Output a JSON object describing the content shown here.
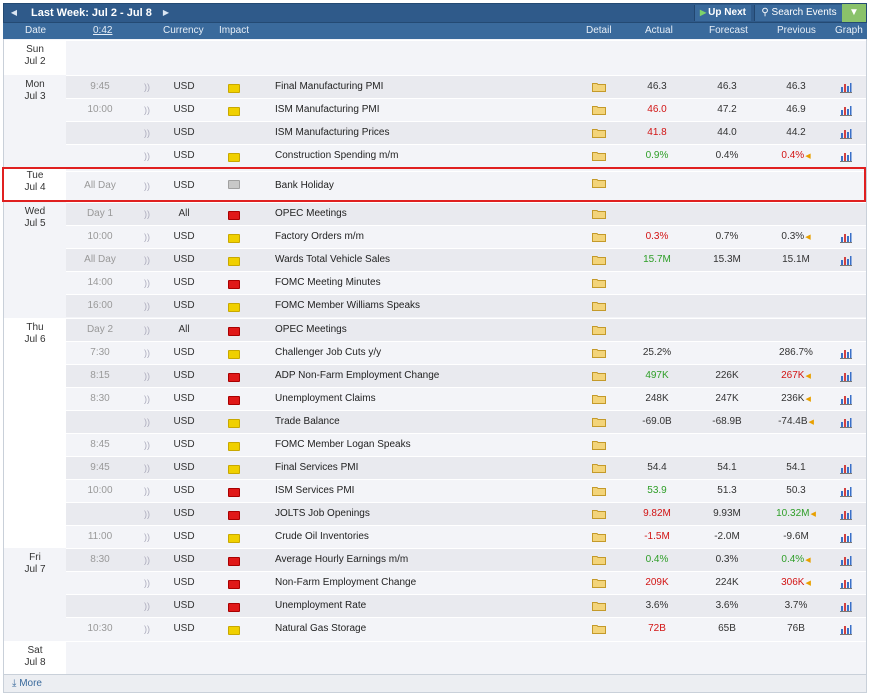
{
  "toolbar": {
    "prev_arrow": "◀",
    "title": "Last Week: Jul 2 - Jul 8",
    "next_arrow": "▶",
    "up_next_label": "Up Next",
    "search_label": "Search Events",
    "filter_icon": "filter-icon"
  },
  "columns": {
    "date": "Date",
    "time": "0:42",
    "currency": "Currency",
    "impact": "Impact",
    "detail": "Detail",
    "actual": "Actual",
    "forecast": "Forecast",
    "previous": "Previous",
    "graph": "Graph"
  },
  "colors": {
    "header_bg": "#3a6a9c",
    "actual_better": "#2e9e27",
    "actual_worse": "#d21414",
    "impact_high": "#e01818",
    "impact_medium": "#f28c28",
    "impact_low": "#f0d000",
    "impact_holiday": "#c8c8c8",
    "highlight_border": "#e02020"
  },
  "days": [
    {
      "line1": "Sun",
      "line2": "Jul 2"
    },
    {
      "line1": "Mon",
      "line2": "Jul 3"
    },
    {
      "line1": "Tue",
      "line2": "Jul 4"
    },
    {
      "line1": "Wed",
      "line2": "Jul 5"
    },
    {
      "line1": "Thu",
      "line2": "Jul 6"
    },
    {
      "line1": "Fri",
      "line2": "Jul 7"
    },
    {
      "line1": "Sat",
      "line2": "Jul 8"
    }
  ],
  "events": [
    {
      "time": "9:45",
      "currency": "USD",
      "impact": "low",
      "name": "Final Manufacturing PMI",
      "actual": "46.3",
      "actual_class": "",
      "forecast": "46.3",
      "previous": "46.3",
      "previous_class": "",
      "revised": false,
      "has_graph": true
    },
    {
      "time": "10:00",
      "currency": "USD",
      "impact": "low",
      "name": "ISM Manufacturing PMI",
      "actual": "46.0",
      "actual_class": "red",
      "forecast": "47.2",
      "previous": "46.9",
      "previous_class": "",
      "revised": false,
      "has_graph": true
    },
    {
      "time": "",
      "currency": "USD",
      "impact": "medium",
      "name": "ISM Manufacturing Prices",
      "actual": "41.8",
      "actual_class": "red",
      "forecast": "44.0",
      "previous": "44.2",
      "previous_class": "",
      "revised": false,
      "has_graph": true
    },
    {
      "time": "",
      "currency": "USD",
      "impact": "low",
      "name": "Construction Spending m/m",
      "actual": "0.9%",
      "actual_class": "green",
      "forecast": "0.4%",
      "previous": "0.4%",
      "previous_class": "red",
      "revised": true,
      "has_graph": true
    },
    {
      "time": "All Day",
      "currency": "USD",
      "impact": "none",
      "name": "Bank Holiday",
      "actual": "",
      "actual_class": "",
      "forecast": "",
      "previous": "",
      "previous_class": "",
      "revised": false,
      "has_graph": false
    },
    {
      "time": "Day 1",
      "currency": "All",
      "impact": "high",
      "name": "OPEC Meetings",
      "actual": "",
      "actual_class": "",
      "forecast": "",
      "previous": "",
      "previous_class": "",
      "revised": false,
      "has_graph": false
    },
    {
      "time": "10:00",
      "currency": "USD",
      "impact": "low",
      "name": "Factory Orders m/m",
      "actual": "0.3%",
      "actual_class": "red",
      "forecast": "0.7%",
      "previous": "0.3%",
      "previous_class": "",
      "revised": true,
      "has_graph": true
    },
    {
      "time": "All Day",
      "currency": "USD",
      "impact": "low",
      "name": "Wards Total Vehicle Sales",
      "actual": "15.7M",
      "actual_class": "green",
      "forecast": "15.3M",
      "previous": "15.1M",
      "previous_class": "",
      "revised": false,
      "has_graph": true
    },
    {
      "time": "14:00",
      "currency": "USD",
      "impact": "high",
      "name": "FOMC Meeting Minutes",
      "actual": "",
      "actual_class": "",
      "forecast": "",
      "previous": "",
      "previous_class": "",
      "revised": false,
      "has_graph": false
    },
    {
      "time": "16:00",
      "currency": "USD",
      "impact": "low",
      "name": "FOMC Member Williams Speaks",
      "actual": "",
      "actual_class": "",
      "forecast": "",
      "previous": "",
      "previous_class": "",
      "revised": false,
      "has_graph": false
    },
    {
      "time": "Day 2",
      "currency": "All",
      "impact": "high",
      "name": "OPEC Meetings",
      "actual": "",
      "actual_class": "",
      "forecast": "",
      "previous": "",
      "previous_class": "",
      "revised": false,
      "has_graph": false
    },
    {
      "time": "7:30",
      "currency": "USD",
      "impact": "low",
      "name": "Challenger Job Cuts y/y",
      "actual": "25.2%",
      "actual_class": "",
      "forecast": "",
      "previous": "286.7%",
      "previous_class": "",
      "revised": false,
      "has_graph": true
    },
    {
      "time": "8:15",
      "currency": "USD",
      "impact": "high",
      "name": "ADP Non-Farm Employment Change",
      "actual": "497K",
      "actual_class": "green",
      "forecast": "226K",
      "previous": "267K",
      "previous_class": "red",
      "revised": true,
      "has_graph": true
    },
    {
      "time": "8:30",
      "currency": "USD",
      "impact": "high",
      "name": "Unemployment Claims",
      "actual": "248K",
      "actual_class": "",
      "forecast": "247K",
      "previous": "236K",
      "previous_class": "",
      "revised": true,
      "has_graph": true
    },
    {
      "time": "",
      "currency": "USD",
      "impact": "low",
      "name": "Trade Balance",
      "actual": "-69.0B",
      "actual_class": "",
      "forecast": "-68.9B",
      "previous": "-74.4B",
      "previous_class": "",
      "revised": true,
      "has_graph": true
    },
    {
      "time": "8:45",
      "currency": "USD",
      "impact": "low",
      "name": "FOMC Member Logan Speaks",
      "actual": "",
      "actual_class": "",
      "forecast": "",
      "previous": "",
      "previous_class": "",
      "revised": false,
      "has_graph": false
    },
    {
      "time": "9:45",
      "currency": "USD",
      "impact": "low",
      "name": "Final Services PMI",
      "actual": "54.4",
      "actual_class": "",
      "forecast": "54.1",
      "previous": "54.1",
      "previous_class": "",
      "revised": false,
      "has_graph": true
    },
    {
      "time": "10:00",
      "currency": "USD",
      "impact": "high",
      "name": "ISM Services PMI",
      "actual": "53.9",
      "actual_class": "green",
      "forecast": "51.3",
      "previous": "50.3",
      "previous_class": "",
      "revised": false,
      "has_graph": true
    },
    {
      "time": "",
      "currency": "USD",
      "impact": "high",
      "name": "JOLTS Job Openings",
      "actual": "9.82M",
      "actual_class": "red",
      "forecast": "9.93M",
      "previous": "10.32M",
      "previous_class": "green",
      "revised": true,
      "has_graph": true
    },
    {
      "time": "11:00",
      "currency": "USD",
      "impact": "low",
      "name": "Crude Oil Inventories",
      "actual": "-1.5M",
      "actual_class": "red",
      "forecast": "-2.0M",
      "previous": "-9.6M",
      "previous_class": "",
      "revised": false,
      "has_graph": true
    },
    {
      "time": "8:30",
      "currency": "USD",
      "impact": "high",
      "name": "Average Hourly Earnings m/m",
      "actual": "0.4%",
      "actual_class": "green",
      "forecast": "0.3%",
      "previous": "0.4%",
      "previous_class": "green",
      "revised": true,
      "has_graph": true
    },
    {
      "time": "",
      "currency": "USD",
      "impact": "high",
      "name": "Non-Farm Employment Change",
      "actual": "209K",
      "actual_class": "red",
      "forecast": "224K",
      "previous": "306K",
      "previous_class": "red",
      "revised": true,
      "has_graph": true
    },
    {
      "time": "",
      "currency": "USD",
      "impact": "high",
      "name": "Unemployment Rate",
      "actual": "3.6%",
      "actual_class": "",
      "forecast": "3.6%",
      "previous": "3.7%",
      "previous_class": "",
      "revised": false,
      "has_graph": true
    },
    {
      "time": "10:30",
      "currency": "USD",
      "impact": "low",
      "name": "Natural Gas Storage",
      "actual": "72B",
      "actual_class": "red",
      "forecast": "65B",
      "previous": "76B",
      "previous_class": "",
      "revised": false,
      "has_graph": true
    }
  ],
  "footer": {
    "more_icon": "download-arrow-icon",
    "more_label": "More"
  }
}
